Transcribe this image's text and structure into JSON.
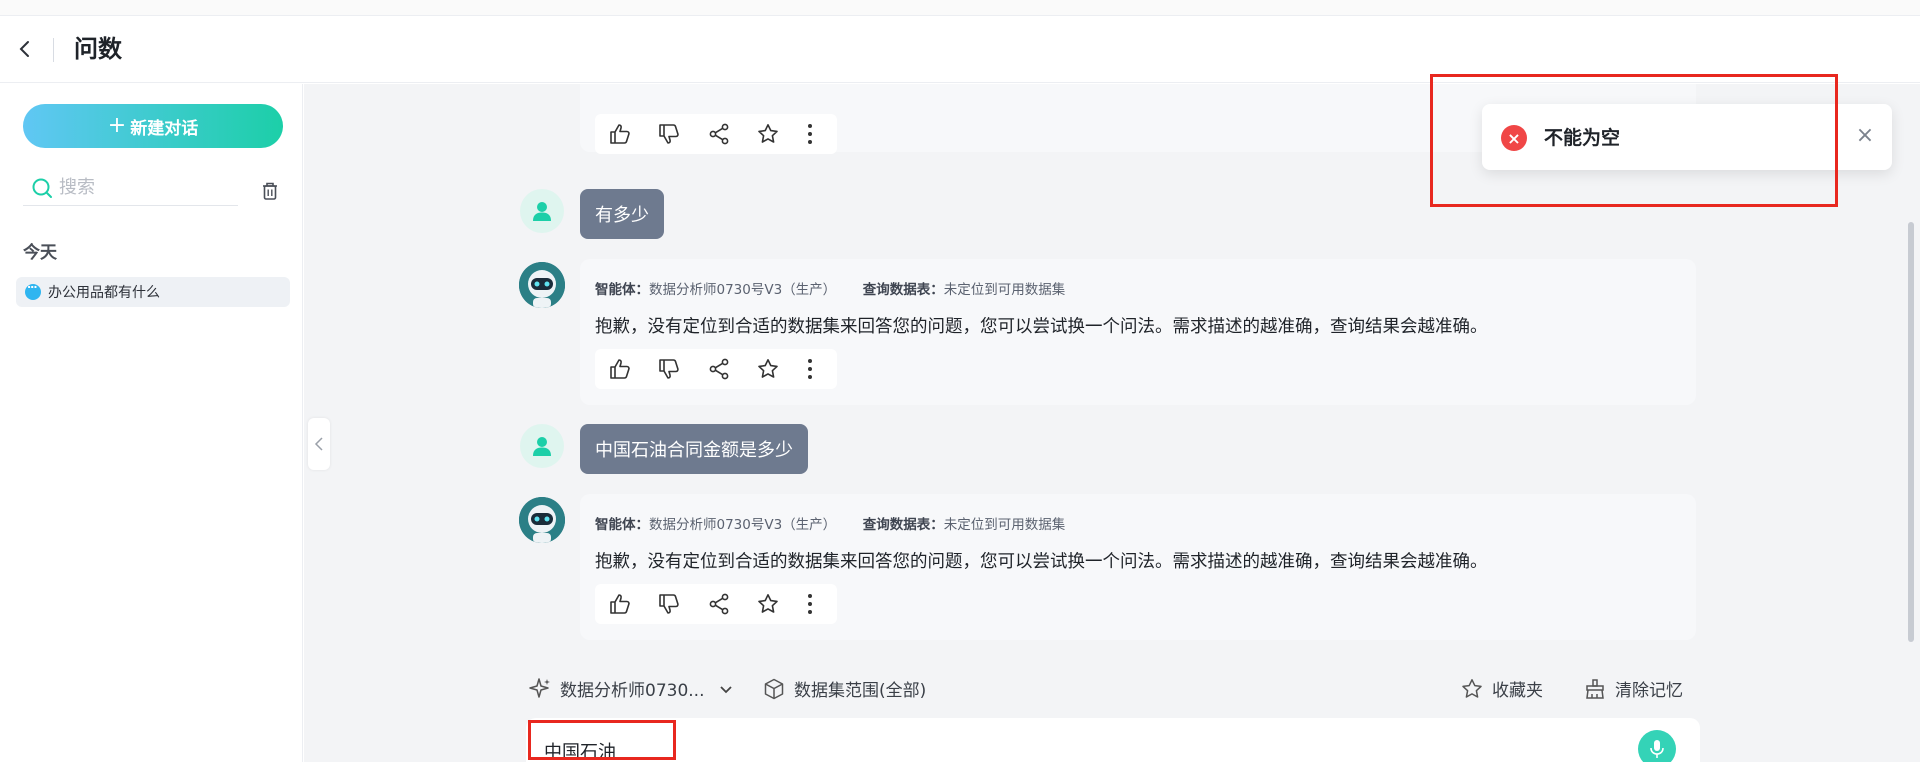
{
  "header": {
    "title": "问数"
  },
  "sidebar": {
    "new_chat_label": "新建对话",
    "search_placeholder": "搜索",
    "section_today": "今天",
    "history": [
      {
        "label": "办公用品都有什么"
      }
    ]
  },
  "chat": {
    "messages": [
      {
        "role": "user",
        "text": "有多少"
      },
      {
        "role": "bot",
        "agent_key": "智能体：",
        "agent_value": "数据分析师0730号V3（生产）",
        "table_key": "查询数据表：",
        "table_value": "未定位到可用数据集",
        "answer": "抱歉，没有定位到合适的数据集来回答您的问题，您可以尝试换一个问法。需求描述的越准确，查询结果会越准确。"
      },
      {
        "role": "user",
        "text": "中国石油合同金额是多少"
      },
      {
        "role": "bot",
        "agent_key": "智能体：",
        "agent_value": "数据分析师0730号V3（生产）",
        "table_key": "查询数据表：",
        "table_value": "未定位到可用数据集",
        "answer": "抱歉，没有定位到合适的数据集来回答您的问题，您可以尝试换一个问法。需求描述的越准确，查询结果会越准确。"
      }
    ]
  },
  "toolbar": {
    "agent_select": "数据分析师0730...",
    "dataset_range": "数据集范围(全部)",
    "favorites": "收藏夹",
    "clear_memory": "清除记忆"
  },
  "input": {
    "value": "中国石油"
  },
  "toast": {
    "message": "不能为空"
  },
  "colors": {
    "accent": "#1ccfa8",
    "user_bubble": "#6e7a8f",
    "error": "#f04646",
    "highlight_box": "#e8281f"
  },
  "icons": [
    "back-icon",
    "plus-icon",
    "search-icon",
    "trash-icon",
    "chat-dot-icon",
    "thumbs-up-icon",
    "thumbs-down-icon",
    "share-icon",
    "star-icon",
    "more-icon",
    "user-icon",
    "robot-icon",
    "sparkle-icon",
    "chevron-down-icon",
    "cube-icon",
    "broom-icon",
    "mic-icon",
    "error-icon",
    "close-icon",
    "chevron-left-icon"
  ]
}
